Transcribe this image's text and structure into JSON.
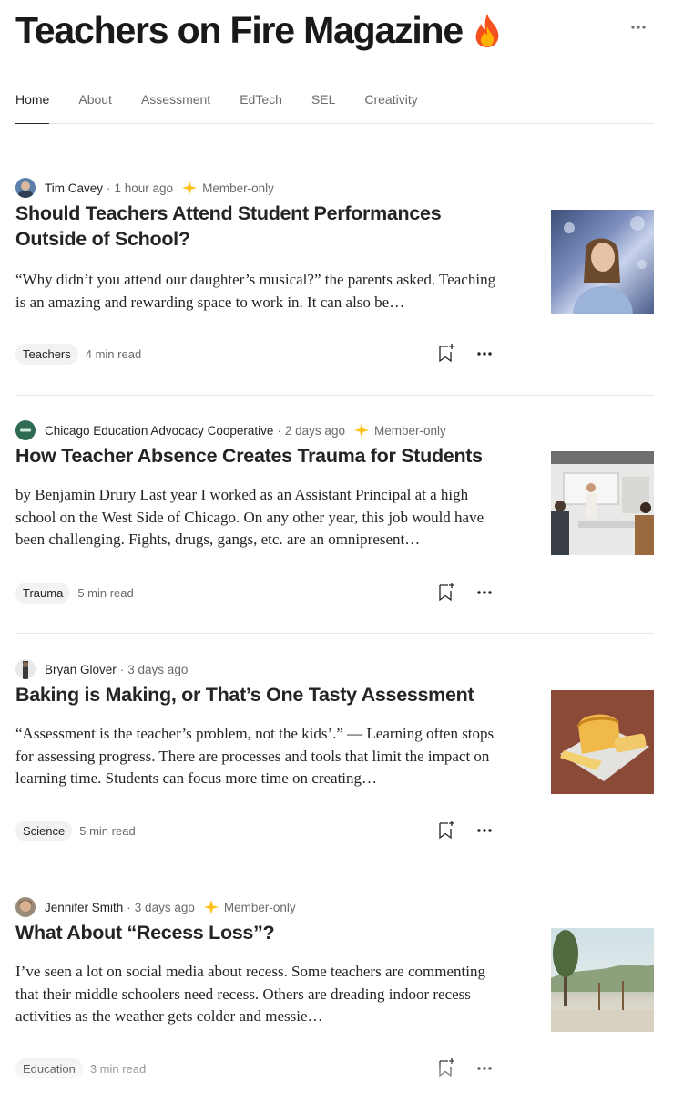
{
  "publication": {
    "title": "Teachers on Fire Magazine",
    "emoji": "fire-icon"
  },
  "tabs": [
    {
      "label": "Home",
      "active": true
    },
    {
      "label": "About",
      "active": false
    },
    {
      "label": "Assessment",
      "active": false
    },
    {
      "label": "EdTech",
      "active": false
    },
    {
      "label": "SEL",
      "active": false
    },
    {
      "label": "Creativity",
      "active": false
    }
  ],
  "articles": [
    {
      "author": "Tim Cavey",
      "time": "1 hour ago",
      "member_only": "Member-only",
      "title": "Should Teachers Attend Student Performances Outside of School?",
      "excerpt": "“Why didn’t you attend our daughter’s musical?” the parents asked. Teaching is an amazing and rewarding space to work in. It can also be…",
      "tag": "Teachers",
      "read_time": "4 min read"
    },
    {
      "author": "Chicago Education Advocacy Cooperative",
      "time": "2 days ago",
      "member_only": "Member-only",
      "title": "How Teacher Absence Creates Trauma for Students",
      "excerpt": "by Benjamin Drury Last year I worked as an Assistant Principal at a high school on the West Side of Chicago. On any other year, this job would have been challenging. Fights, drugs, gangs, etc. are an omnipresent…",
      "tag": "Trauma",
      "read_time": "5 min read"
    },
    {
      "author": "Bryan Glover",
      "time": "3 days ago",
      "member_only": "",
      "title": "Baking is Making, or That’s One Tasty Assessment",
      "excerpt": "“Assessment is the teacher’s problem, not the kids’.” — Learning often stops for assessing progress. There are processes and tools that limit the impact on learning time. Students can focus more time on creating…",
      "tag": "Science",
      "read_time": "5 min read"
    },
    {
      "author": "Jennifer Smith",
      "time": "3 days ago",
      "member_only": "Member-only",
      "title": "What About “Recess Loss”?",
      "excerpt": "I’ve seen a lot on social media about recess. Some teachers are commenting that their middle schoolers need recess. Others are dreading indoor recess activities as the weather gets colder and messie…",
      "tag": "Education",
      "read_time": "3 min read"
    }
  ],
  "colors": {
    "member_star": "#ffc017",
    "text": "#242424",
    "muted": "#6b6b6b",
    "divider": "#e6e6e6"
  }
}
